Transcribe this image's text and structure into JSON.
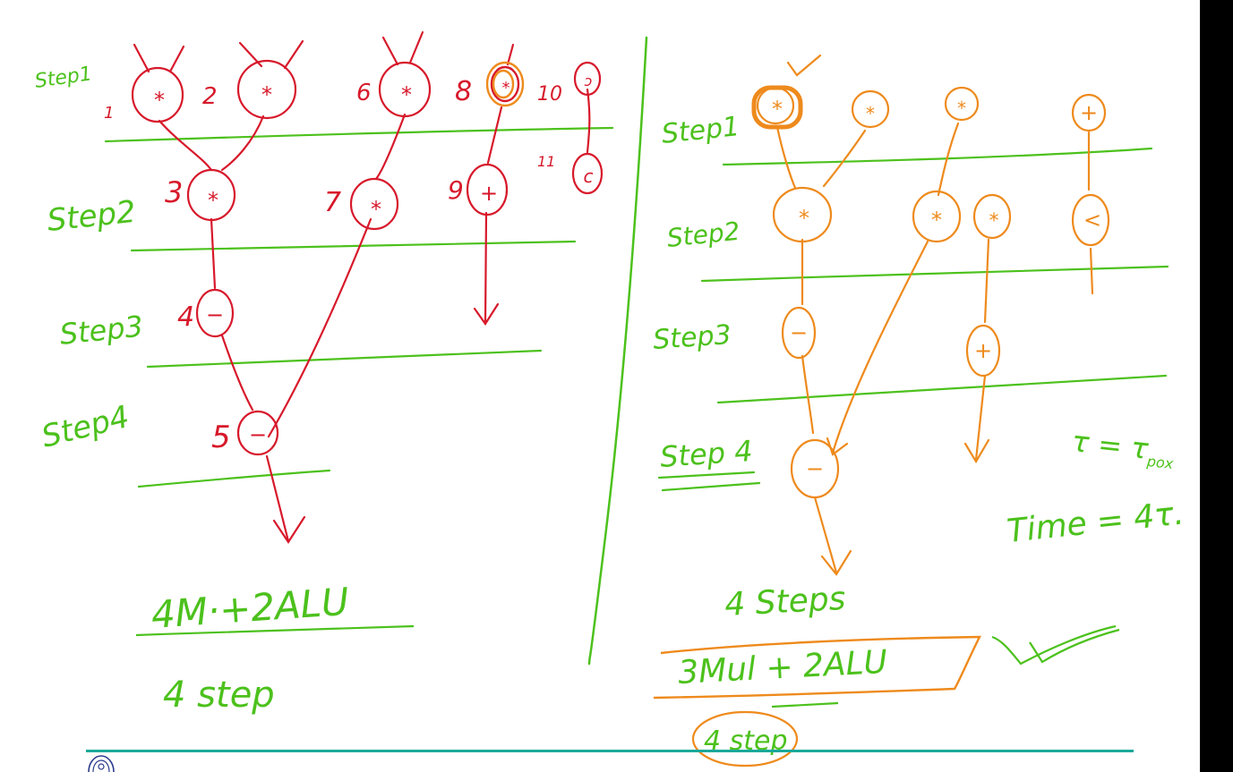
{
  "colors": {
    "green": "#4cc11c",
    "red": "#d7192b",
    "orange": "#ee8a1c",
    "teal": "#1aa89a",
    "border": "#000000"
  },
  "left": {
    "step_labels": [
      "Step1",
      "Step2",
      "Step3",
      "Step4"
    ],
    "node_numbers": [
      "1",
      "2",
      "3",
      "4",
      "5",
      "6",
      "7",
      "8",
      "9",
      "10",
      "11"
    ],
    "operators": {
      "n1": "*",
      "n2": "*",
      "n3": "*",
      "n4": "−",
      "n5": "−",
      "n6": "*",
      "n7": "*",
      "n8": "*",
      "n9": "+",
      "n10": "ↄ",
      "n11": "c"
    },
    "summary": "4M·+2ALU",
    "steps_text": "4 step"
  },
  "right": {
    "step_labels": [
      "Step1",
      "Step2",
      "Step3",
      "Step 4"
    ],
    "operators": {
      "r1": "*",
      "r2": "*",
      "r3": "*",
      "r4": "+",
      "r5": "*",
      "r6": "*",
      "r7": "*",
      "r8": "<",
      "r9": "−",
      "r10": "+",
      "r11": "−"
    },
    "tau_note": "τ = τ",
    "tau_sub": "pox",
    "time_note": "Time = 4τ.",
    "steps_count": "4 Steps",
    "summary_boxed": "3Mul + 2ALU",
    "steps_circled": "4 step"
  },
  "footer": {
    "logo_icon": "institute-emblem-icon"
  }
}
